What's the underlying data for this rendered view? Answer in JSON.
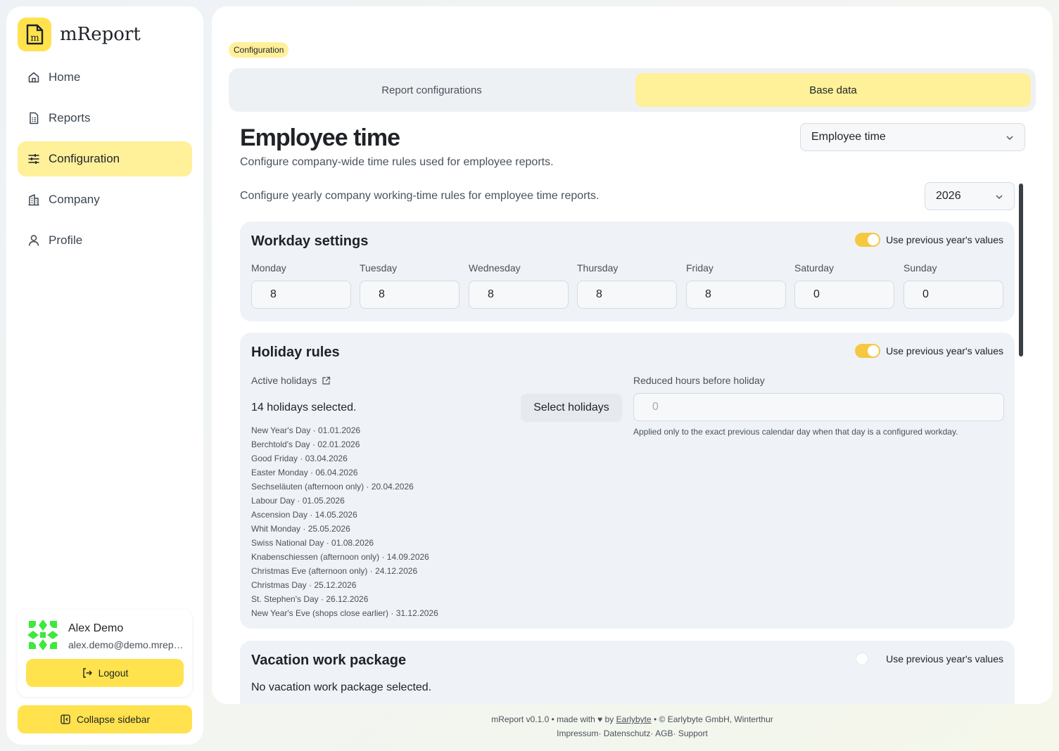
{
  "app": {
    "name": "mReport",
    "logo_letter": "m"
  },
  "sidebar": {
    "items": [
      {
        "label": "Home",
        "icon": "home-icon",
        "active": false
      },
      {
        "label": "Reports",
        "icon": "document-icon",
        "active": false
      },
      {
        "label": "Configuration",
        "icon": "sliders-icon",
        "active": true
      },
      {
        "label": "Company",
        "icon": "building-icon",
        "active": false
      },
      {
        "label": "Profile",
        "icon": "user-icon",
        "active": false
      }
    ],
    "user": {
      "name": "Alex Demo",
      "email": "alex.demo@demo.mreport.ch"
    },
    "logout_label": "Logout",
    "collapse_label": "Collapse sidebar"
  },
  "main": {
    "breadcrumb": "Configuration",
    "tabs": [
      {
        "label": "Report configurations",
        "active": false
      },
      {
        "label": "Base data",
        "active": true
      }
    ],
    "title": "Employee time",
    "subtitle": "Configure company-wide time rules used for employee reports.",
    "section_select": "Employee time",
    "year_intro": "Configure yearly company working-time rules for employee time reports.",
    "year": "2026",
    "use_previous_label": "Use previous year's values",
    "workday": {
      "title": "Workday settings",
      "use_previous": true,
      "days": [
        {
          "label": "Monday",
          "value": "8"
        },
        {
          "label": "Tuesday",
          "value": "8"
        },
        {
          "label": "Wednesday",
          "value": "8"
        },
        {
          "label": "Thursday",
          "value": "8"
        },
        {
          "label": "Friday",
          "value": "8"
        },
        {
          "label": "Saturday",
          "value": "0"
        },
        {
          "label": "Sunday",
          "value": "0"
        }
      ]
    },
    "holiday": {
      "title": "Holiday rules",
      "use_previous": true,
      "active_label": "Active holidays",
      "count_text": "14 holidays selected.",
      "select_button": "Select holidays",
      "list": [
        "New Year's Day · 01.01.2026",
        "Berchtold's Day · 02.01.2026",
        "Good Friday · 03.04.2026",
        "Easter Monday · 06.04.2026",
        "Sechseläuten (afternoon only) · 20.04.2026",
        "Labour Day · 01.05.2026",
        "Ascension Day · 14.05.2026",
        "Whit Monday · 25.05.2026",
        "Swiss National Day · 01.08.2026",
        "Knabenschiessen (afternoon only) · 14.09.2026",
        "Christmas Eve (afternoon only) · 24.12.2026",
        "Christmas Day · 25.12.2026",
        "St. Stephen's Day · 26.12.2026",
        "New Year's Eve (shops close earlier) · 31.12.2026"
      ],
      "reduced_label": "Reduced hours before holiday",
      "reduced_placeholder": "0",
      "reduced_help": "Applied only to the exact previous calendar day when that day is a configured workday."
    },
    "vacation": {
      "title": "Vacation work package",
      "use_previous": false,
      "clipped_text": "No vacation work package selected."
    }
  },
  "footer": {
    "line1_prefix": "mReport v0.1.0 • made with ♥ by",
    "line1_link": "Earlybyte",
    "line1_suffix": "• © Earlybyte GmbH, Winterthur",
    "links": [
      "Impressum",
      "Datenschutz",
      "AGB",
      "Support"
    ]
  },
  "colors": {
    "accent": "#ffe24d",
    "accent_soft": "#fff09a",
    "toggle_on": "#f5c842",
    "card_bg": "#eff2f6"
  }
}
